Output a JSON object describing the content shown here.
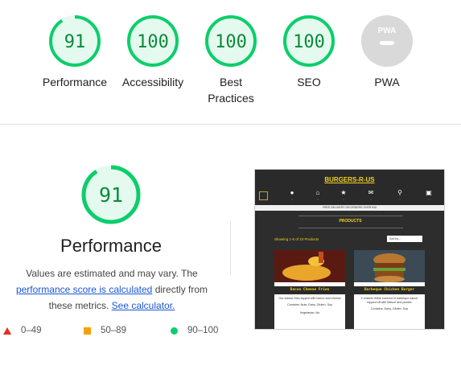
{
  "colors": {
    "pass": "#0cce6b",
    "pass_text": "#0a8a3a",
    "pass_bg": "#e5faef",
    "fail": "#e52b20",
    "average": "#f5a300",
    "pwa_grey": "#d9d9d9"
  },
  "categories": [
    {
      "label": "Performance",
      "score": 91,
      "display": "91"
    },
    {
      "label": "Accessibility",
      "score": 100,
      "display": "100"
    },
    {
      "label": "Best Practices",
      "score": 100,
      "display": "100"
    },
    {
      "label": "SEO",
      "score": 100,
      "display": "100"
    },
    {
      "label": "PWA",
      "score": null,
      "display": "",
      "badge_text": "PWA"
    }
  ],
  "performance": {
    "score": 91,
    "display": "91",
    "title": "Performance",
    "desc_part1": "Values are estimated and may vary. The ",
    "desc_link1": "performance score is calculated",
    "desc_part2": " directly from these metrics. ",
    "desc_link2": "See calculator."
  },
  "legend": [
    {
      "shape": "triangle",
      "label": "0–49"
    },
    {
      "shape": "square",
      "label": "50–89"
    },
    {
      "shape": "circle",
      "label": "90–100"
    }
  ],
  "thumbnail": {
    "brand": "BURGERS-R-US",
    "menu_icon": "hamburger-menu-icon",
    "nav_icons": [
      "user-icon",
      "home-icon",
      "star-icon",
      "mail-icon",
      "search-icon",
      "cart-icon"
    ],
    "strip": "FREE DELIVERY ON ORDERS OVER €10",
    "heading": "PRODUCTS",
    "showing": "Showing 1-6 of 23 Products",
    "sort": "Sort by...",
    "cards": [
      {
        "title": "Bacon Cheese Fries",
        "desc": "Our classic fries topped with bacon and cheese",
        "contains": "Contains:  Nuts, Dairy, Gluten, Soy",
        "veg": "Vegetarian:  No"
      },
      {
        "title": "Barbeque Chicken Burger",
        "desc": "2 chicken fillets covered in barbeque sauce topped off with lettuce and pickles",
        "contains": "Contains:  Dairy, Gluten, Soy",
        "veg": ""
      }
    ]
  }
}
